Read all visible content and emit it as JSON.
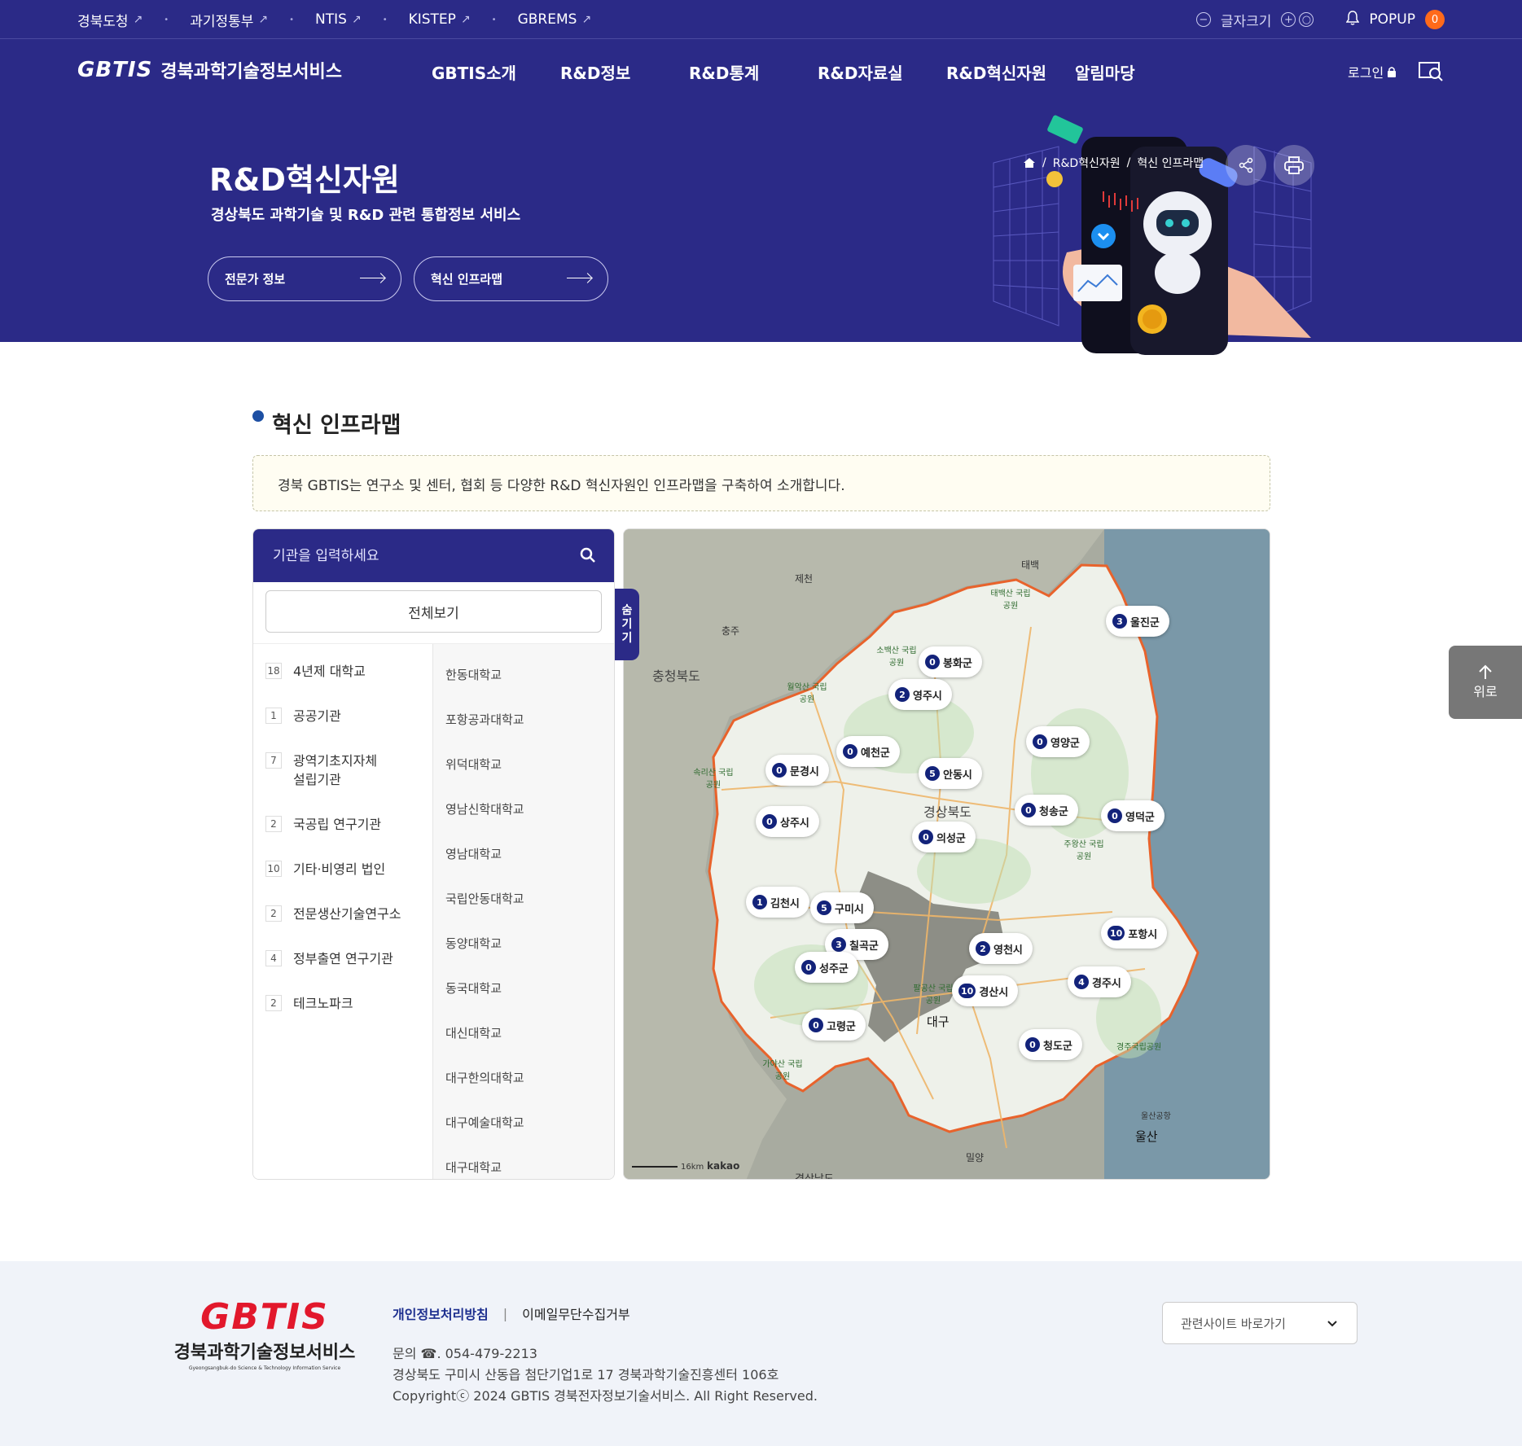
{
  "topbar": {
    "links": [
      "경북도청",
      "과기정통부",
      "NTIS",
      "KISTEP",
      "GBREMS"
    ],
    "font_size_label": "글자크기",
    "popup_label": "POPUP",
    "popup_count": "0"
  },
  "header": {
    "logo_en": "GBTIS",
    "logo_ko": "경북과학기술정보서비스",
    "menu": [
      "GBTIS소개",
      "R&D정보",
      "R&D통계",
      "R&D자료실",
      "R&D혁신자원",
      "알림마당"
    ],
    "login": "로그인"
  },
  "hero": {
    "title": "R&D혁신자원",
    "subtitle": "경상북도 과학기술 및 R&D 관련 통합정보 서비스",
    "buttons": [
      "전문가 정보",
      "혁신 인프라맵"
    ],
    "breadcrumb": [
      "R&D혁신자원",
      "혁신 인프라맵"
    ]
  },
  "section": {
    "title": "혁신 인프라맵",
    "intro": "경북 GBTIS는 연구소 및 센터, 협회 등 다양한 R&D 혁신자원인 인프라맵을 구축하여 소개합니다."
  },
  "panel": {
    "search_placeholder": "기관을 입력하세요",
    "all_button": "전체보기",
    "hide_tab": [
      "숨",
      "기",
      "기"
    ],
    "categories": [
      {
        "count": "18",
        "label": "4년제 대학교"
      },
      {
        "count": "1",
        "label": "공공기관"
      },
      {
        "count": "7",
        "label": "광역기초지자체 설립기관"
      },
      {
        "count": "2",
        "label": "국공립 연구기관"
      },
      {
        "count": "10",
        "label": "기타·비영리 법인"
      },
      {
        "count": "2",
        "label": "전문생산기술연구소"
      },
      {
        "count": "4",
        "label": "정부출연 연구기관"
      },
      {
        "count": "2",
        "label": "테크노파크"
      }
    ],
    "institutions": [
      "한동대학교",
      "포항공과대학교",
      "위덕대학교",
      "영남신학대학교",
      "영남대학교",
      "국립안동대학교",
      "동양대학교",
      "동국대학교",
      "대신대학교",
      "대구한의대학교",
      "대구예술대학교",
      "대구대학교"
    ]
  },
  "map": {
    "pins": [
      {
        "n": "3",
        "name": "울진군"
      },
      {
        "n": "0",
        "name": "봉화군"
      },
      {
        "n": "2",
        "name": "영주시"
      },
      {
        "n": "0",
        "name": "예천군"
      },
      {
        "n": "0",
        "name": "문경시"
      },
      {
        "n": "5",
        "name": "안동시"
      },
      {
        "n": "0",
        "name": "영양군"
      },
      {
        "n": "0",
        "name": "청송군"
      },
      {
        "n": "0",
        "name": "영덕군"
      },
      {
        "n": "0",
        "name": "상주시"
      },
      {
        "n": "0",
        "name": "의성군"
      },
      {
        "n": "1",
        "name": "김천시"
      },
      {
        "n": "5",
        "name": "구미시"
      },
      {
        "n": "3",
        "name": "칠곡군"
      },
      {
        "n": "0",
        "name": "성주군"
      },
      {
        "n": "2",
        "name": "영천시"
      },
      {
        "n": "10",
        "name": "포항시"
      },
      {
        "n": "4",
        "name": "경주시"
      },
      {
        "n": "10",
        "name": "경산시"
      },
      {
        "n": "0",
        "name": "고령군"
      },
      {
        "n": "0",
        "name": "청도군"
      }
    ],
    "labels": [
      "제천",
      "태백",
      "충주",
      "충청북도",
      "경상북도",
      "대구",
      "울산",
      "밀양",
      "소백산 국립공원",
      "월악산 국립공원",
      "속리산 국립공원",
      "주왕산 국립공원",
      "팔공산 국립공원",
      "가야산 국립공원",
      "경주국립공원",
      "태백산 국립공원",
      "울산공항",
      "경상남도"
    ],
    "scale": "16km",
    "brand": "kakao"
  },
  "to_top": "위로",
  "footer": {
    "logo_en": "GBTIS",
    "logo_ko": "경북과학기술정보서비스",
    "logo_small": "Gyeongsangbuk-do Science & Technology Information Service",
    "privacy": "개인정보처리방침",
    "email_refuse": "이메일무단수집거부",
    "contact": "문의 ☎. 054-479-2213",
    "address": "경상북도 구미시 산동읍 첨단기업1로 17 경북과학기술진흥센터 106호",
    "copyright": "Copyrightⓒ 2024 GBTIS 경북전자정보기술서비스. All Right Reserved.",
    "related_select": "관련사이트 바로가기"
  }
}
